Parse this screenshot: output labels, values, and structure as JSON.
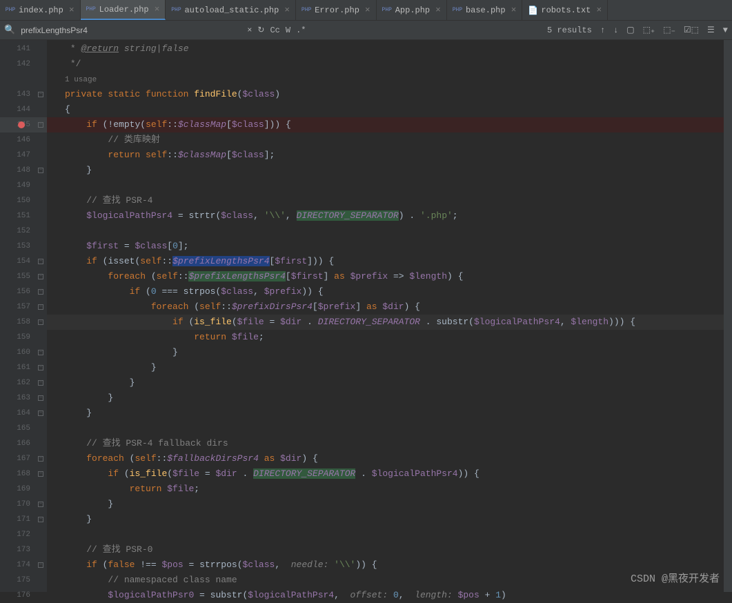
{
  "tabs": [
    {
      "label": "index.php",
      "type": "php"
    },
    {
      "label": "Loader.php",
      "type": "php",
      "active": true
    },
    {
      "label": "autoload_static.php",
      "type": "php"
    },
    {
      "label": "Error.php",
      "type": "php"
    },
    {
      "label": "App.php",
      "type": "php"
    },
    {
      "label": "base.php",
      "type": "php"
    },
    {
      "label": "robots.txt",
      "type": "txt"
    }
  ],
  "search": {
    "value": "prefixLengthsPsr4",
    "results": "5 results",
    "cc": "Cc",
    "w": "W"
  },
  "lines": {
    "start": 141,
    "end": 176
  },
  "usage_text": "1 usage",
  "watermark": "CSDN @黑夜开发者",
  "code": {
    "l141": "     * @return string|false",
    "l142": "     */",
    "l143_kw": "private static function",
    "l143_fn": "findFile",
    "l143_var": "$class",
    "l145_if": "if",
    "l145_empty": "empty",
    "l145_self": "self",
    "l145_classMap": "$classMap",
    "l145_class": "$class",
    "l146_cmt": "// 类库映射",
    "l147_return": "return",
    "l150_cmt": "// 查找 PSR-4",
    "l151_var": "$logicalPathPsr4",
    "l151_strtr": "strtr",
    "l151_slash": "'\\\\'",
    "l151_dirsep": "DIRECTORY_SEPARATOR",
    "l151_php": "'.php'",
    "l153_first": "$first",
    "l153_zero": "0",
    "l154_isset": "isset",
    "l154_plp4": "$prefixLengthsPsr4",
    "l155_foreach": "foreach",
    "l155_as": "as",
    "l155_prefix": "$prefix",
    "l155_length": "$length",
    "l156_strpos": "strpos",
    "l157_pdp4": "$prefixDirsPsr4",
    "l157_dir": "$dir",
    "l158_isfile": "is_file",
    "l158_file": "$file",
    "l158_substr": "substr",
    "l166_cmt": "// 查找 PSR-4 fallback dirs",
    "l167_fbdp4": "$fallbackDirsPsr4",
    "l173_cmt": "// 查找 PSR-0",
    "l174_false": "false",
    "l174_pos": "$pos",
    "l174_strrpos": "strrpos",
    "l174_needle": "needle:",
    "l175_cmt": "// namespaced class name",
    "l176_lpp0": "$logicalPathPsr0",
    "l176_offset": "offset:",
    "l176_length": "length:",
    "l176_one": "1"
  }
}
